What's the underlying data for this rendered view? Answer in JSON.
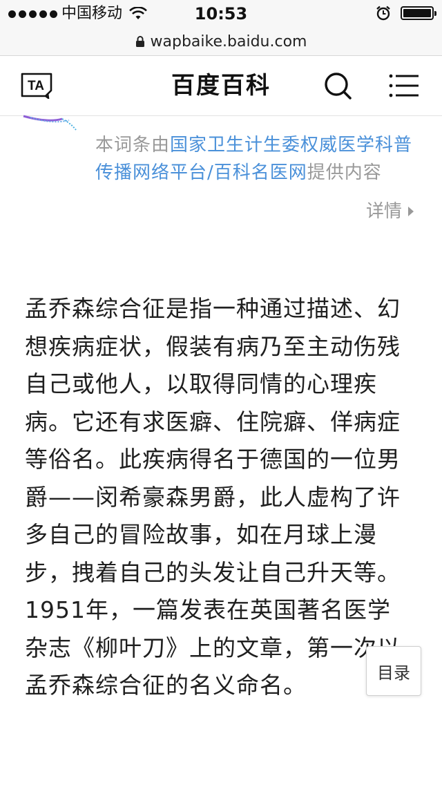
{
  "status_bar": {
    "carrier": "中国移动",
    "time": "10:53"
  },
  "url_bar": {
    "domain": "wapbaike.baidu.com"
  },
  "header": {
    "logo_text": "TA",
    "title": "百度百科"
  },
  "source_note": {
    "prefix": "本词条由",
    "link": "国家卫生计生委权威医学科普传播网络平台/百科名医网",
    "suffix": "提供内容",
    "detail_label": "详情"
  },
  "article": {
    "body": "孟乔森综合征是指一种通过描述、幻想疾病症状，假装有病乃至主动伤残自己或他人，以取得同情的心理疾病。它还有求医癖、住院癖、佯病症等俗名。此疾病得名于德国的一位男爵——闵希豪森男爵，此人虚构了许多自己的冒险故事，如在月球上漫步，拽着自己的头发让自己升天等。1951年，一篇发表在英国著名医学杂志《柳叶刀》上的文章，第一次以孟乔森综合征的名义命名。"
  },
  "toc_button": {
    "label": "目录"
  },
  "colors": {
    "link": "#4a90d9",
    "muted": "#999999",
    "text": "#1f1f1f"
  }
}
